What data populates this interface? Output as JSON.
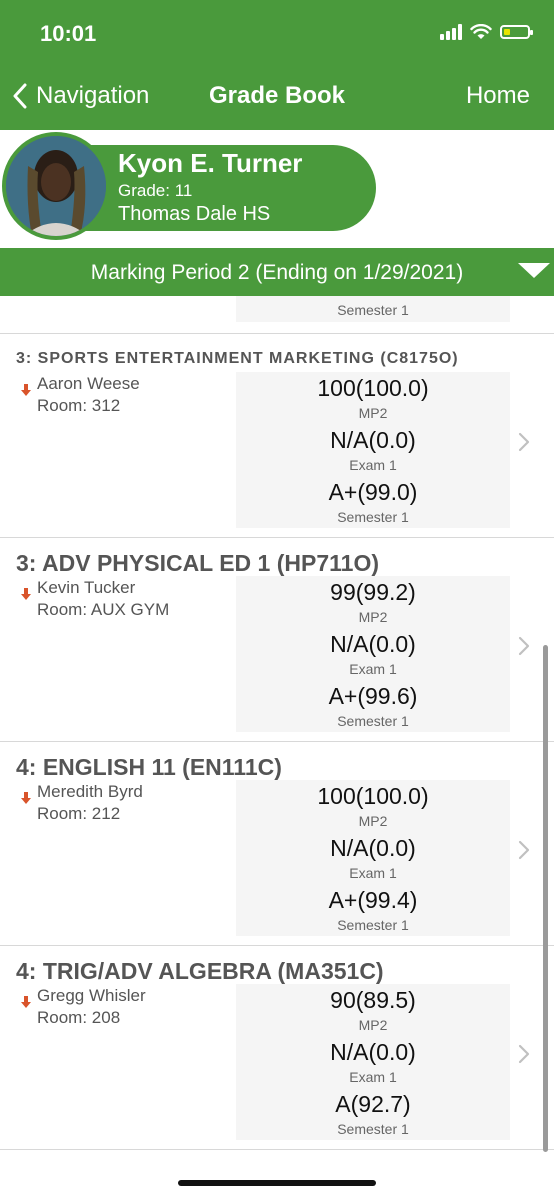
{
  "status_bar": {
    "time": "10:01"
  },
  "nav": {
    "back_label": "Navigation",
    "title": "Grade Book",
    "home_label": "Home"
  },
  "student": {
    "name": "Kyon E. Turner",
    "grade": "Grade: 11",
    "school": "Thomas Dale HS"
  },
  "marking_period": {
    "label": "Marking Period 2 (Ending on 1/29/2021)"
  },
  "partial_card": {
    "label": "Semester 1"
  },
  "courses": [
    {
      "title": "3: SPORTS ENTERTAINMENT MARKETING (C8175O)",
      "teacher": "Aaron Weese",
      "room": "Room: 312",
      "grades": [
        {
          "value": "100(100.0)",
          "label": "MP2"
        },
        {
          "value": "N/A(0.0)",
          "label": "Exam 1"
        },
        {
          "value": "A+(99.0)",
          "label": "Semester 1"
        }
      ]
    },
    {
      "title": "3: ADV PHYSICAL ED 1 (HP711O)",
      "teacher": "Kevin Tucker",
      "room": "Room: AUX GYM",
      "grades": [
        {
          "value": "99(99.2)",
          "label": "MP2"
        },
        {
          "value": "N/A(0.0)",
          "label": "Exam 1"
        },
        {
          "value": "A+(99.6)",
          "label": "Semester 1"
        }
      ]
    },
    {
      "title": "4: ENGLISH 11 (EN111C)",
      "teacher": "Meredith Byrd",
      "room": "Room: 212",
      "grades": [
        {
          "value": "100(100.0)",
          "label": "MP2"
        },
        {
          "value": "N/A(0.0)",
          "label": "Exam 1"
        },
        {
          "value": "A+(99.4)",
          "label": "Semester 1"
        }
      ]
    },
    {
      "title": "4: TRIG/ADV ALGEBRA (MA351C)",
      "teacher": "Gregg Whisler",
      "room": "Room: 208",
      "grades": [
        {
          "value": "90(89.5)",
          "label": "MP2"
        },
        {
          "value": "N/A(0.0)",
          "label": "Exam 1"
        },
        {
          "value": "A(92.7)",
          "label": "Semester 1"
        }
      ]
    }
  ],
  "colors": {
    "brand_green": "#4a9a3c",
    "trend_down_arrow": "#d9542b"
  }
}
